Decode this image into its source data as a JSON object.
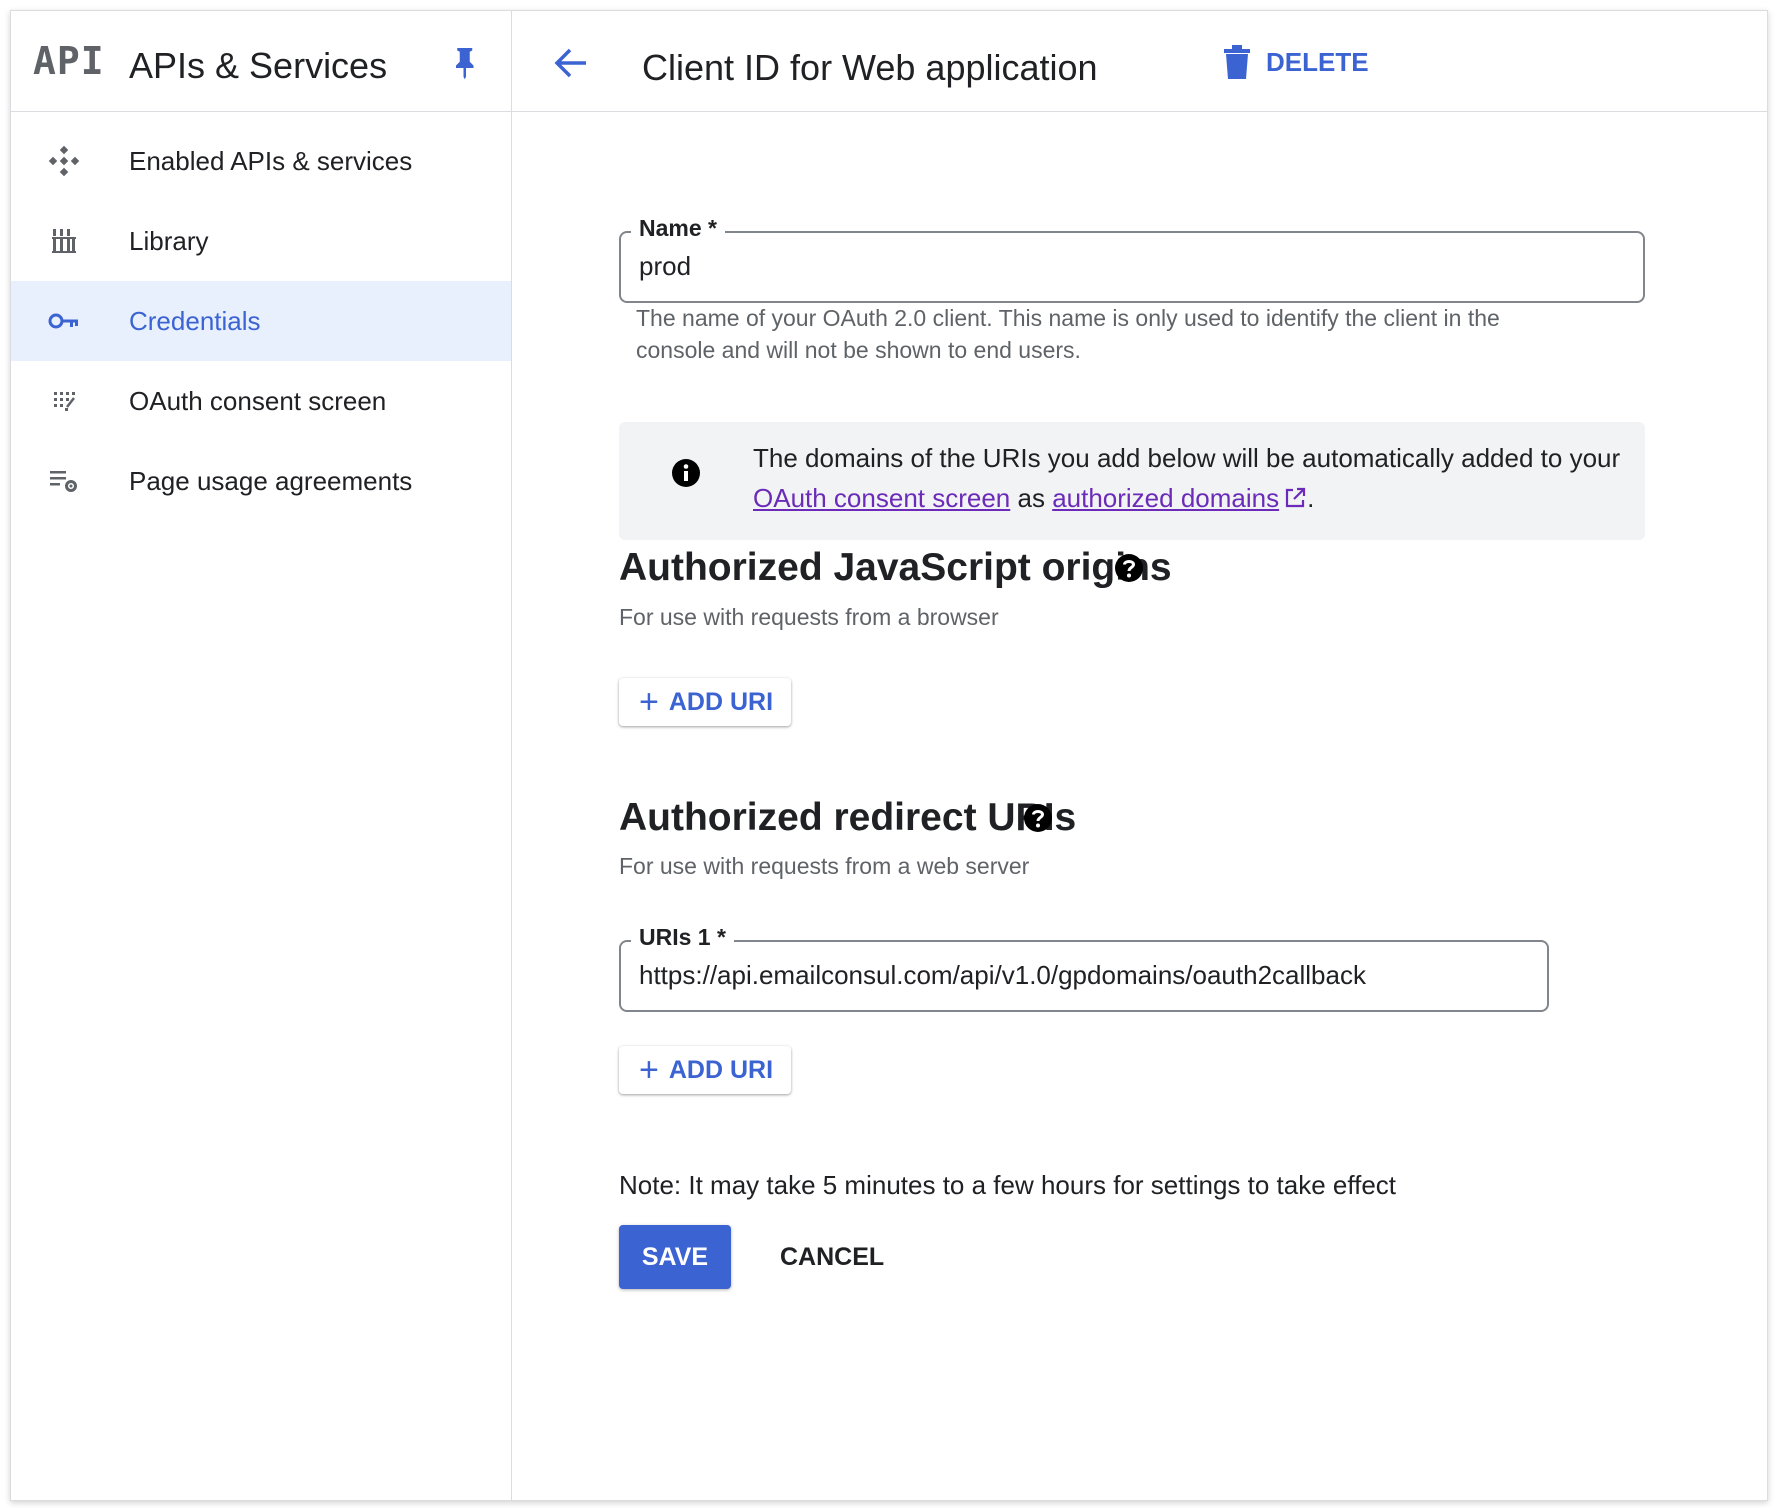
{
  "sidebar": {
    "logo": "API",
    "title": "APIs & Services",
    "items": [
      {
        "label": "Enabled APIs & services",
        "icon": "apis-diamond-icon"
      },
      {
        "label": "Library",
        "icon": "library-icon"
      },
      {
        "label": "Credentials",
        "icon": "key-icon",
        "active": true
      },
      {
        "label": "OAuth consent screen",
        "icon": "consent-screen-icon"
      },
      {
        "label": "Page usage agreements",
        "icon": "settings-list-icon"
      }
    ]
  },
  "header": {
    "title": "Client ID for Web application",
    "delete_label": "DELETE"
  },
  "form": {
    "name": {
      "label": "Name *",
      "value": "prod",
      "helper": "The name of your OAuth 2.0 client. This name is only used to identify the client in the console and will not be shown to end users."
    },
    "info": {
      "text_before": "The domains of the URIs you add below will be automatically added to your ",
      "link1": "OAuth consent screen",
      "text_middle": " as ",
      "link2": "authorized domains",
      "text_after": "."
    },
    "js_origins": {
      "title": "Authorized JavaScript origins",
      "subtitle": "For use with requests from a browser",
      "add_label": "ADD URI"
    },
    "redirect_uris": {
      "title": "Authorized redirect URIs",
      "subtitle": "For use with requests from a web server",
      "uri_label": "URIs 1 *",
      "uri_value": "https://api.emailconsul.com/api/v1.0/gpdomains/oauth2callback",
      "add_label": "ADD URI"
    },
    "note": "Note: It may take 5 minutes to a few hours for settings to take effect",
    "save_label": "SAVE",
    "cancel_label": "CANCEL"
  },
  "colors": {
    "accent": "#3b63d2",
    "active_bg": "#e8f0fe",
    "link": "#6b2bb8",
    "info_bg": "#f1f3f4"
  }
}
